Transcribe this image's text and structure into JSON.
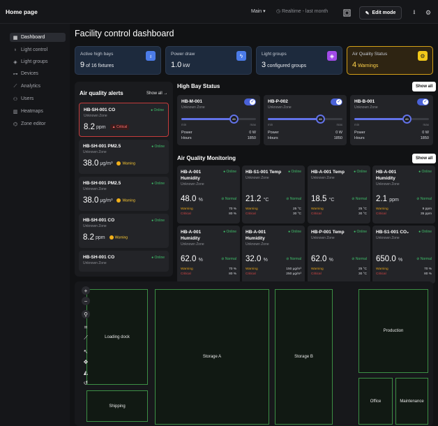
{
  "topbar": {
    "title": "Home page",
    "view_select": "Main",
    "realtime": "Realtime - last month",
    "edit_mode_label": "Edit mode",
    "icons": [
      "screen-icon",
      "pencil-icon",
      "download-icon",
      "settings-icon"
    ]
  },
  "sidebar": {
    "items": [
      {
        "label": "Dashboard",
        "icon": "grid-icon"
      },
      {
        "label": "Light control",
        "icon": "bulb-icon"
      },
      {
        "label": "Light groups",
        "icon": "layers-icon"
      },
      {
        "label": "Devices",
        "icon": "devices-icon"
      },
      {
        "label": "Analytics",
        "icon": "trend-icon"
      },
      {
        "label": "Users",
        "icon": "users-icon"
      },
      {
        "label": "Heatmaps",
        "icon": "heatmap-icon"
      },
      {
        "label": "Zone editor",
        "icon": "zone-icon"
      }
    ],
    "active_index": 0
  },
  "page_title": "Facility control dashboard",
  "kpis": [
    {
      "label": "Active high bays",
      "value": "9",
      "suffix": "of 16 fixtures",
      "icon": "bulb-icon",
      "icon_color": "#4b7be8"
    },
    {
      "label": "Power draw",
      "value": "1.0",
      "suffix": "kW",
      "icon": "bolt-icon",
      "icon_color": "#4b7be8"
    },
    {
      "label": "Light groups",
      "value": "3",
      "suffix": "configured groups",
      "icon": "layers-icon",
      "icon_color": "#a24be8"
    },
    {
      "label": "Air Quality Status",
      "value": "4",
      "suffix": "Warnings",
      "icon": "gear-icon",
      "icon_color": "#f2c81a"
    }
  ],
  "air_alerts": {
    "title": "Air quality alerts",
    "show_all": "Show all →",
    "cards": [
      {
        "name": "HB-SH-001 CO",
        "zone": "Unknown Zone",
        "status": "Online",
        "value": "8.2",
        "unit": "ppm",
        "badge": "Critical",
        "severity": "critical"
      },
      {
        "name": "HB-SH-001 PM2.5",
        "zone": "Unknown Zone",
        "status": "Online",
        "value": "38.0",
        "unit": "μg/m³",
        "badge": "Warning",
        "severity": "warning"
      },
      {
        "name": "HB-SH-001 PM2.5",
        "zone": "Unknown Zone",
        "status": "Online",
        "value": "38.0",
        "unit": "μg/m³",
        "badge": "Warning",
        "severity": "warning"
      },
      {
        "name": "HB-SH-001 CO",
        "zone": "Unknown Zone",
        "status": "Online",
        "value": "8.2",
        "unit": "ppm",
        "badge": "Warning",
        "severity": "warning"
      },
      {
        "name": "HB-SH-001 CO",
        "zone": "Unknown Zone",
        "status": "Online",
        "value": "",
        "unit": "",
        "badge": "",
        "severity": ""
      }
    ]
  },
  "high_bay": {
    "title": "High Bay Status",
    "show_all": "Show all",
    "min_label": "min",
    "max_label": "max",
    "power_label": "Power",
    "hours_label": "Hours",
    "cards": [
      {
        "name": "HB-M-001",
        "zone": "Unknown Zone",
        "level": 85,
        "level_label": "85",
        "power": "0 W",
        "hours": "1850"
      },
      {
        "name": "HB-P-002",
        "zone": "Unknown Zone",
        "level": 85,
        "level_label": "85",
        "power": "0 W",
        "hours": "1850"
      },
      {
        "name": "HB-B-001",
        "zone": "Unknown Zone",
        "level": 85,
        "level_label": "85",
        "power": "0 W",
        "hours": "1850"
      }
    ]
  },
  "aq_monitoring": {
    "title": "Air Quality Monitoring",
    "show_all": "Show all",
    "warning_label": "Warning",
    "critical_label": "Critical",
    "cards": [
      {
        "name": "HB-A-001 Humidity",
        "zone": "Unknown Zone",
        "status": "Online",
        "value": "48.0",
        "unit": "%",
        "state": "Normal",
        "warn": "70 %",
        "crit": "80 %"
      },
      {
        "name": "HB-S1-001 Temp",
        "zone": "Unknown Zone",
        "status": "Online",
        "value": "21.2",
        "unit": "°C",
        "state": "Normal",
        "warn": "25 °C",
        "crit": "30 °C"
      },
      {
        "name": "HB-A-001 Temp",
        "zone": "Unknown Zone",
        "status": "Online",
        "value": "18.5",
        "unit": "°C",
        "state": "Normal",
        "warn": "25 °C",
        "crit": "30 °C"
      },
      {
        "name": "HB-A-001 Humidity",
        "zone": "Unknown Zone",
        "status": "Online",
        "value": "2.1",
        "unit": "ppm",
        "state": "Normal",
        "warn": "9 ppm",
        "crit": "35 ppm"
      },
      {
        "name": "HB-A-001 Humidity",
        "zone": "Unknown Zone",
        "status": "Online",
        "value": "62.0",
        "unit": "%",
        "state": "Normal",
        "warn": "70 %",
        "crit": "80 %"
      },
      {
        "name": "HB-A-001 Humidity",
        "zone": "Unknown Zone",
        "status": "Online",
        "value": "32.0",
        "unit": "%",
        "state": "Normal",
        "warn": "150 μg/m³",
        "crit": "250 μg/m³"
      },
      {
        "name": "HB-P-001 Temp",
        "zone": "Unknown Zone",
        "status": "Online",
        "value": "62.0",
        "unit": "%",
        "state": "Normal",
        "warn": "25 °C",
        "crit": "30 °C"
      },
      {
        "name": "HB-S1-001 CO₂",
        "zone": "Unknown Zone",
        "status": "Online",
        "value": "650.0",
        "unit": "%",
        "state": "Normal",
        "warn": "70 %",
        "crit": "80 %"
      }
    ]
  },
  "map": {
    "zones": [
      "Loading dock",
      "Storage A",
      "Storage B",
      "Production",
      "Shipping",
      "Office",
      "Maintenance"
    ],
    "tools": [
      "zoom-in-icon",
      "zoom-out-icon",
      "pin-icon",
      "select-icon",
      "draw-icon",
      "pointer-icon",
      "move-icon",
      "erase-icon",
      "rotate-icon"
    ]
  }
}
